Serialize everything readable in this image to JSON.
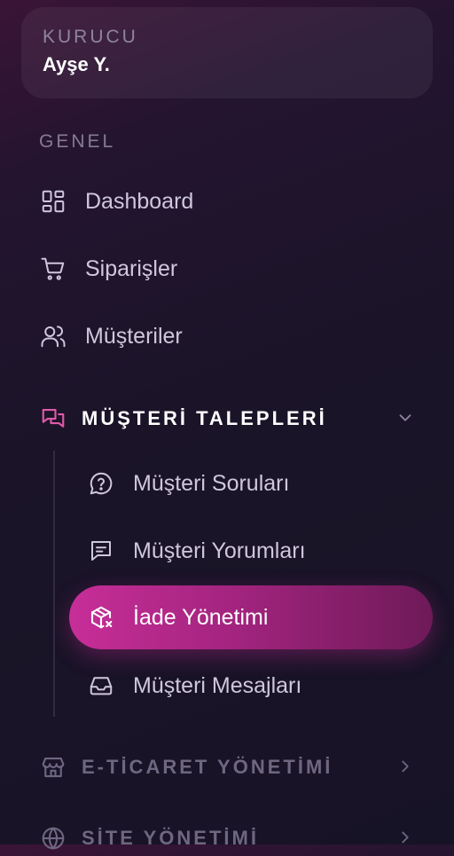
{
  "profile": {
    "role": "KURUCU",
    "name": "Ayşe Y."
  },
  "sections": {
    "general": "GENEL"
  },
  "nav": {
    "dashboard": "Dashboard",
    "orders": "Siparişler",
    "customers": "Müşteriler"
  },
  "customer_requests": {
    "title": "MÜŞTERİ TALEPLERİ",
    "items": {
      "questions": "Müşteri Soruları",
      "reviews": "Müşteri Yorumları",
      "returns": "İade Yönetimi",
      "messages": "Müşteri Mesajları"
    }
  },
  "ecommerce": {
    "title": "E-TİCARET YÖNETİMİ"
  },
  "site": {
    "title": "SİTE YÖNETİMİ"
  },
  "colors": {
    "accent": "#c72e98",
    "accent_icon": "#e05aa8",
    "background": "#1b1428"
  }
}
